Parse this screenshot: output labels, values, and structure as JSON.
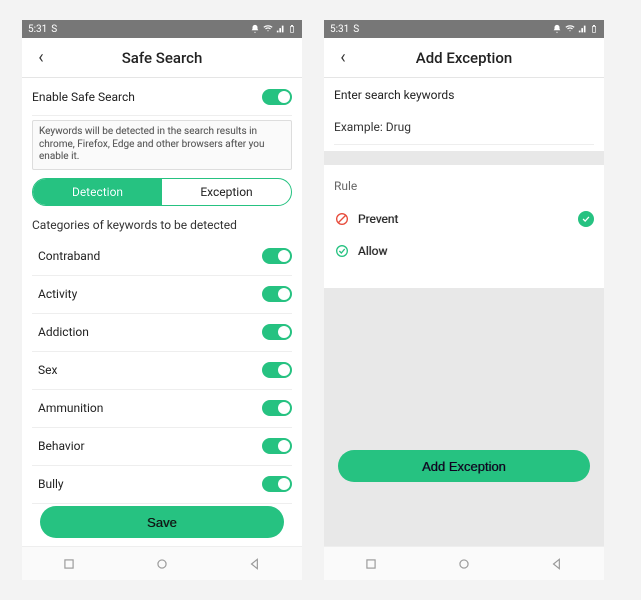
{
  "status": {
    "time": "5:31",
    "icon": "S"
  },
  "left": {
    "title": "Safe Search",
    "enableLabel": "Enable Safe Search",
    "info": "Keywords will be detected in the search results in chrome, Firefox, Edge and other browsers after you enable it.",
    "tabs": {
      "detection": "Detection",
      "exception": "Exception"
    },
    "catHeader": "Categories of keywords to be detected",
    "categories": [
      {
        "label": "Contraband",
        "on": true
      },
      {
        "label": "Activity",
        "on": true
      },
      {
        "label": "Addiction",
        "on": true
      },
      {
        "label": "Sex",
        "on": true
      },
      {
        "label": "Ammunition",
        "on": true
      },
      {
        "label": "Behavior",
        "on": true
      },
      {
        "label": "Bully",
        "on": true
      }
    ],
    "saveLabel": "Save"
  },
  "right": {
    "title": "Add Exception",
    "enterLabel": "Enter search keywords",
    "exampleLabel": "Example: Drug",
    "ruleLabel": "Rule",
    "rules": {
      "prevent": "Prevent",
      "allow": "Allow"
    },
    "addLabel": "Add Exception"
  }
}
